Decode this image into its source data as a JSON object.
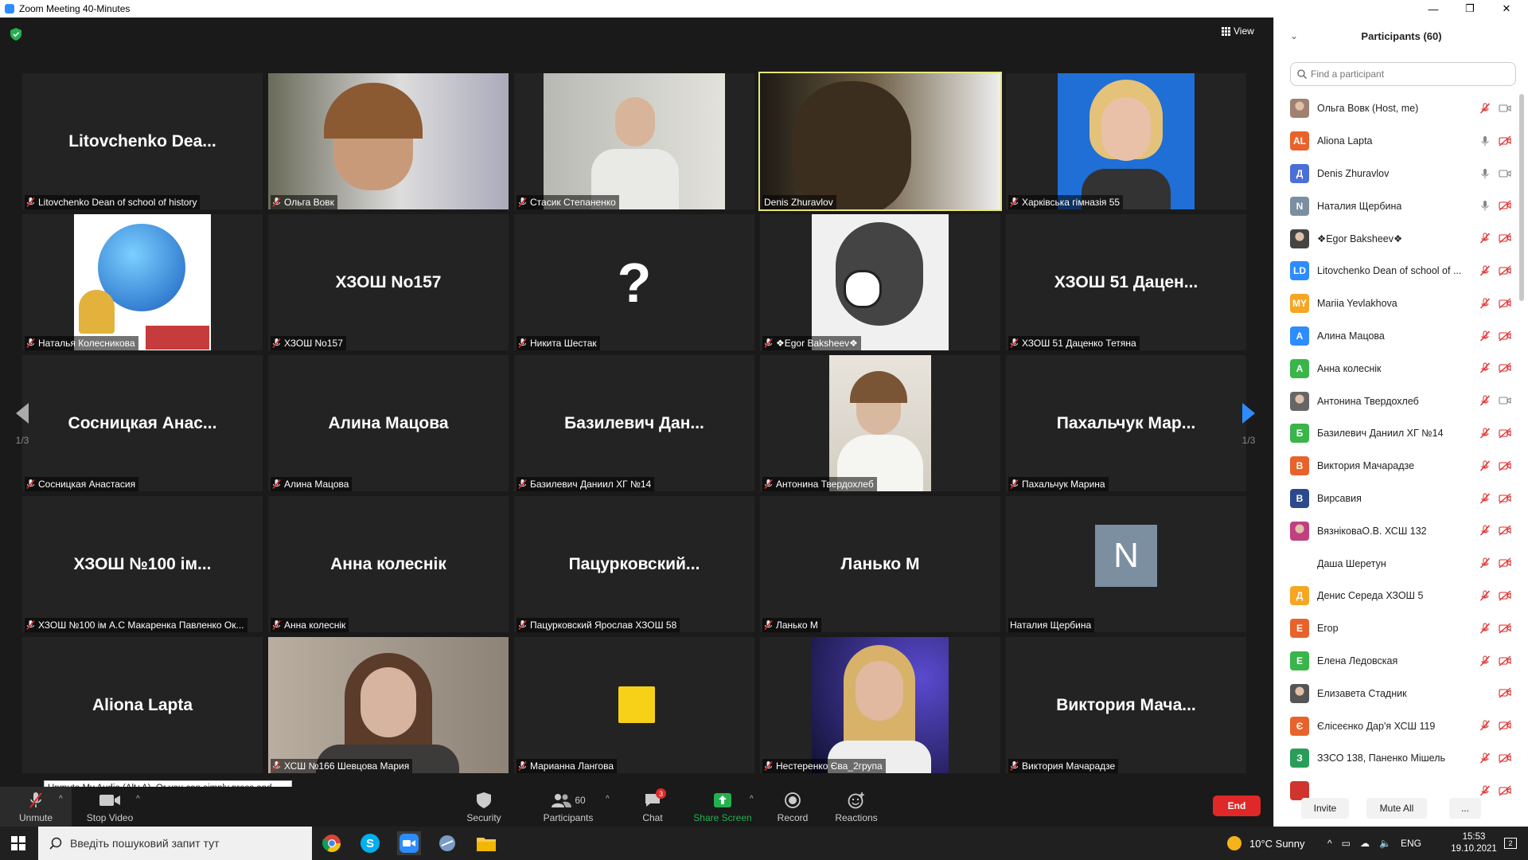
{
  "window": {
    "title": "Zoom Meeting 40-Minutes",
    "minimize": "—",
    "restore": "❐",
    "close": "✕"
  },
  "meeting": {
    "view_label": "View",
    "page_indicator_left": "1/3",
    "page_indicator_right": "1/3",
    "tooltip": "Unmute My Audio (Alt+A). Or you can simply press and hold the space bar to temporarily unmute.",
    "tiles": [
      {
        "big": "Litovchenko  Dea...",
        "label": "Litovchenko Dean of school of history",
        "muted": true
      },
      {
        "video": "woman-headset",
        "label": "Ольга Вовк",
        "muted": true
      },
      {
        "video": "teen-boy",
        "label": "Стасик Степаненко",
        "muted": true
      },
      {
        "video": "man-glasses",
        "label": "Denis Zhuravlov",
        "muted": false,
        "active": true
      },
      {
        "video": "blonde-woman",
        "label": "Харківська гімназія 55",
        "muted": true
      },
      {
        "video": "globe-bell",
        "label": "Наталья Колесникова",
        "muted": true
      },
      {
        "big": "ХЗОШ No157",
        "label": "ХЗОШ No157",
        "muted": true
      },
      {
        "big": "?",
        "label": "Никита Шестак",
        "muted": true
      },
      {
        "video": "anime-headphones",
        "label": "❖Egor Baksheev❖",
        "muted": true
      },
      {
        "big": "ХЗОШ 51 Дацен...",
        "label": "ХЗОШ 51 Даценко Тетяна",
        "muted": true
      },
      {
        "big": "Сосницкая  Анас...",
        "label": "Сосницкая Анастасия",
        "muted": true
      },
      {
        "big": "Алина Мацова",
        "label": "Алина Мацова",
        "muted": true
      },
      {
        "big": "Базилевич  Дан...",
        "label": "Базилевич Даниил ХГ №14",
        "muted": true
      },
      {
        "video": "girl-white",
        "label": "Антонина Твердохлеб",
        "muted": true
      },
      {
        "big": "Пахальчук  Мар...",
        "label": "Пахальчук Марина",
        "muted": true
      },
      {
        "big": "ХЗОШ  №100 ім...",
        "label": "ХЗОШ №100 ім А.С Макаренка Павленко Ок...",
        "muted": true
      },
      {
        "big": "Анна колеснік",
        "label": "Анна колеснік",
        "muted": true
      },
      {
        "big": "Пацурковский...",
        "label": "Пацурковский Ярослав ХЗОШ 58",
        "muted": true
      },
      {
        "big": "Ланько М",
        "label": "Ланько М",
        "muted": true
      },
      {
        "avatar": "N",
        "label": "Наталия Щербина",
        "muted": false
      },
      {
        "big": "Aliona Lapta",
        "label": "Aliona Lapta",
        "muted": false,
        "label_hidden": true
      },
      {
        "video": "girl-glasses",
        "label": "ХСШ №166 Шевцова Мария",
        "muted": true
      },
      {
        "video": "yellow-square",
        "label": "Марианна Лангова",
        "muted": true
      },
      {
        "video": "girl-blonde-dark",
        "label": "Нестеренко Єва_2група",
        "muted": true
      },
      {
        "big": "Виктория  Мача...",
        "label": "Виктория Мачарадзе",
        "muted": true
      }
    ]
  },
  "toolbar": {
    "unmute": "Unmute",
    "stop_video": "Stop Video",
    "security": "Security",
    "participants": "Participants",
    "participants_count": "60",
    "chat": "Chat",
    "chat_badge": "3",
    "share_screen": "Share Screen",
    "record": "Record",
    "reactions": "Reactions",
    "end": "End"
  },
  "panel": {
    "title": "Participants (60)",
    "search_placeholder": "Find a participant",
    "invite": "Invite",
    "mute_all": "Mute All",
    "more": "...",
    "participants": [
      {
        "initials": "",
        "photo": true,
        "color": "#a08070",
        "name": "Ольга Вовк (Host, me)",
        "mic": "muted",
        "cam": "on"
      },
      {
        "initials": "AL",
        "color": "#e8632b",
        "name": "Aliona Lapta",
        "mic": "on",
        "cam": "off"
      },
      {
        "initials": "Д",
        "color": "#4a6fd6",
        "name": "Denis Zhuravlov",
        "mic": "on",
        "cam": "on"
      },
      {
        "initials": "N",
        "color": "#7b8fa0",
        "name": "Наталия Щербина",
        "mic": "on",
        "cam": "off"
      },
      {
        "initials": "",
        "photo": true,
        "color": "#444",
        "name": "❖Egor Baksheev❖",
        "mic": "muted",
        "cam": "off"
      },
      {
        "initials": "LD",
        "color": "#2d8cff",
        "name": "Litovchenko Dean of school of ...",
        "mic": "muted",
        "cam": "off"
      },
      {
        "initials": "MY",
        "color": "#f5a623",
        "name": "Mariia Yevlakhova",
        "mic": "muted",
        "cam": "off"
      },
      {
        "initials": "А",
        "color": "#2d8cff",
        "name": "Алина Мацова",
        "mic": "muted",
        "cam": "off"
      },
      {
        "initials": "А",
        "color": "#3ab54a",
        "name": "Анна колеснік",
        "mic": "muted",
        "cam": "off"
      },
      {
        "initials": "",
        "photo": true,
        "color": "#666",
        "name": "Антонина Твердохлеб",
        "mic": "muted",
        "cam": "on"
      },
      {
        "initials": "Б",
        "color": "#3ab54a",
        "name": "Базилевич Даниил ХГ №14",
        "mic": "muted",
        "cam": "off"
      },
      {
        "initials": "В",
        "color": "#e8632b",
        "name": "Виктория Мачарадзе",
        "mic": "muted",
        "cam": "off"
      },
      {
        "initials": "В",
        "color": "#2b4a8c",
        "name": "Вирсавия",
        "mic": "muted",
        "cam": "off"
      },
      {
        "initials": "",
        "photo": true,
        "color": "#c04080",
        "name": "ВязніковаО.В. ХСШ 132",
        "mic": "muted",
        "cam": "off"
      },
      {
        "initials": "",
        "color": "#ffffff",
        "name": "Даша Шеретун",
        "mic": "muted",
        "cam": "off"
      },
      {
        "initials": "Д",
        "color": "#f5a623",
        "name": "Денис Середа ХЗОШ 5",
        "mic": "muted",
        "cam": "off"
      },
      {
        "initials": "Е",
        "color": "#e8632b",
        "name": "Егор",
        "mic": "muted",
        "cam": "off"
      },
      {
        "initials": "Е",
        "color": "#3ab54a",
        "name": "Елена Ледовская",
        "mic": "muted",
        "cam": "off"
      },
      {
        "initials": "",
        "photo": true,
        "color": "#555",
        "name": "Елизавета Стадник",
        "mic": "none",
        "cam": "off"
      },
      {
        "initials": "Є",
        "color": "#e8632b",
        "name": "Єлісеєнко Дар'я ХСШ 119",
        "mic": "muted",
        "cam": "off"
      },
      {
        "initials": "З",
        "color": "#2a9d5a",
        "name": "ЗЗСО 138, Паненко Мішель",
        "mic": "muted",
        "cam": "off"
      },
      {
        "initials": "",
        "color": "#d0342c",
        "name": "",
        "mic": "muted",
        "cam": "off"
      }
    ]
  },
  "taskbar": {
    "search_placeholder": "Введіть пошуковий запит тут",
    "weather": "10°C  Sunny",
    "lang": "ENG",
    "time": "15:53",
    "date": "19.10.2021",
    "notif_count": "2"
  }
}
